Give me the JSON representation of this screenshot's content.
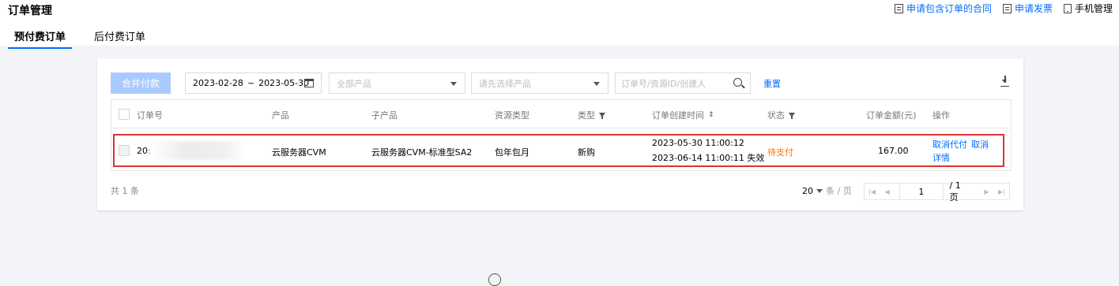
{
  "header": {
    "title": "订单管理",
    "links": [
      {
        "label": "申请包含订单的合同",
        "icon": "document-icon"
      },
      {
        "label": "申请发票",
        "icon": "document-icon"
      },
      {
        "label": "手机管理",
        "icon": "phone-icon"
      }
    ]
  },
  "tabs": [
    {
      "label": "预付费订单",
      "active": true
    },
    {
      "label": "后付费订单",
      "active": false
    }
  ],
  "toolbar": {
    "merge_pay_label": "合并付款",
    "date_start": "2023-02-28",
    "date_sep": "~",
    "date_end": "2023-05-30",
    "product_placeholder": "全部产品",
    "subproduct_placeholder": "请先选择产品",
    "search_placeholder": "订单号/资源ID/创建人",
    "reset_label": "重置"
  },
  "table": {
    "columns": [
      "订单号",
      "产品",
      "子产品",
      "资源类型",
      "类型",
      "订单创建时间",
      "状态",
      "订单金额(元)",
      "操作"
    ],
    "rows": [
      {
        "order_id_visible": "20:",
        "product": "云服务器CVM",
        "subproduct": "云服务器CVM-标准型SA2",
        "resource_type": "包年包月",
        "type": "新购",
        "created": "2023-05-30 11:00:12",
        "expires": "2023-06-14 11:00:11 失效",
        "status": "待支付",
        "amount": "167.00",
        "actions": [
          "取消代付",
          "取消",
          "详情"
        ]
      }
    ]
  },
  "footer": {
    "total": "共 1 条",
    "page_size": "20",
    "page_size_unit": "条 / 页",
    "current_page": "1",
    "total_pages": "/ 1 页"
  },
  "colors": {
    "accent": "#006eff",
    "status_pending": "#ff7200",
    "highlight_border": "#e03131"
  }
}
